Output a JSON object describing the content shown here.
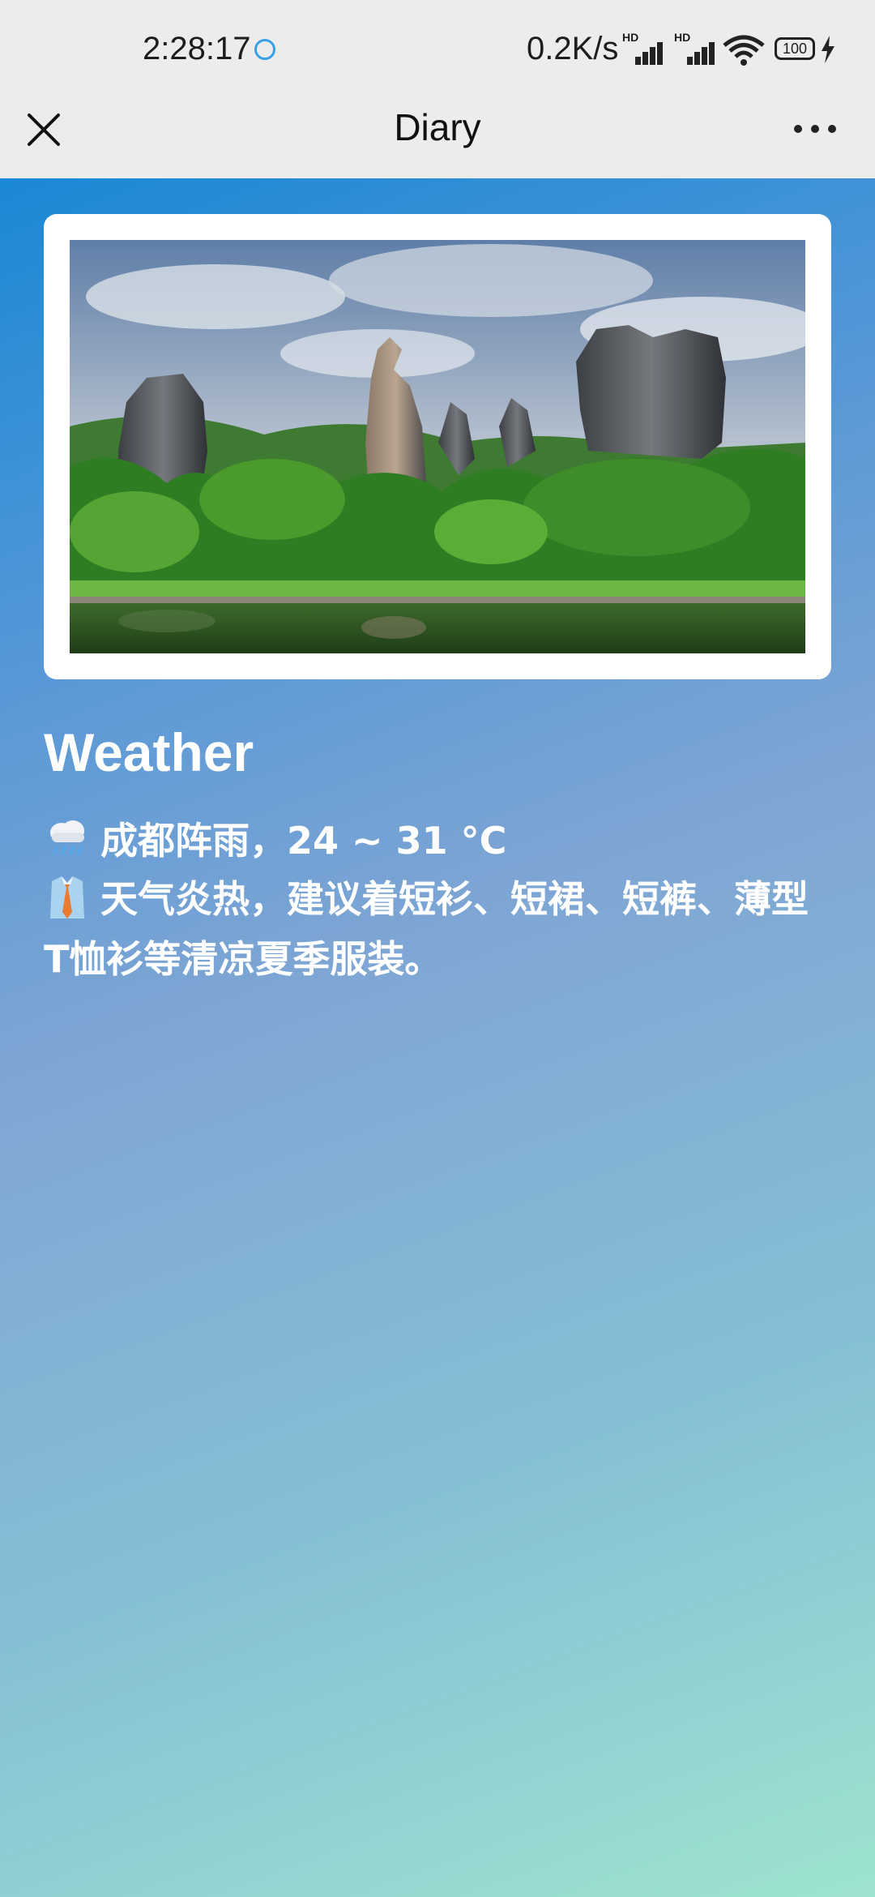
{
  "status_bar": {
    "time": "2:28:17",
    "network_speed": "0.2K/s",
    "hd_label": "HD",
    "battery": "100"
  },
  "nav": {
    "title": "Diary"
  },
  "card": {
    "image_description": "stone-forest-landscape-photo"
  },
  "weather": {
    "heading": "Weather",
    "forecast": "成都阵雨，24 ~ 31 °C",
    "advice": "天气炎热，建议着短衫、短裙、短裤、薄型T恤衫等清凉夏季服装。",
    "forecast_icon": "rain-cloud-icon",
    "advice_icon": "shirt-tie-icon"
  },
  "colors": {
    "gradient_start": "#1a88d6",
    "gradient_end": "#9ee3cf",
    "text": "#ffffff",
    "bar_bg": "#ececec"
  }
}
